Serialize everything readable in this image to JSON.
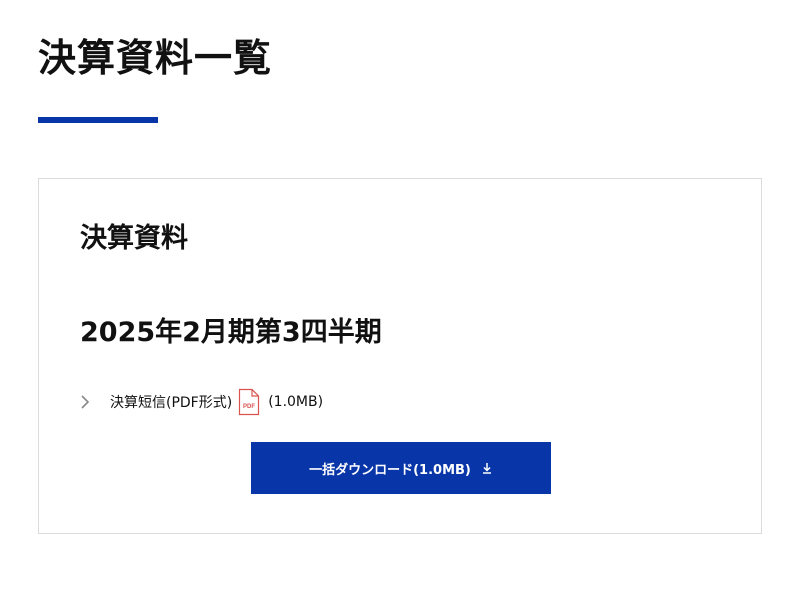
{
  "page": {
    "title": "決算資料一覧"
  },
  "colors": {
    "accent": "#0836a8",
    "card_border": "#dcdcdc",
    "pdf_icon": "#d9534f"
  },
  "section": {
    "heading": "決算資料",
    "period": "2025年2月期第3四半期",
    "documents": [
      {
        "label": "決算短信(PDF形式)",
        "icon": "pdf-icon",
        "size": "(1.0MB)"
      }
    ],
    "download_all_label": "一括ダウンロード(1.0MB)",
    "download_icon": "download-icon"
  }
}
